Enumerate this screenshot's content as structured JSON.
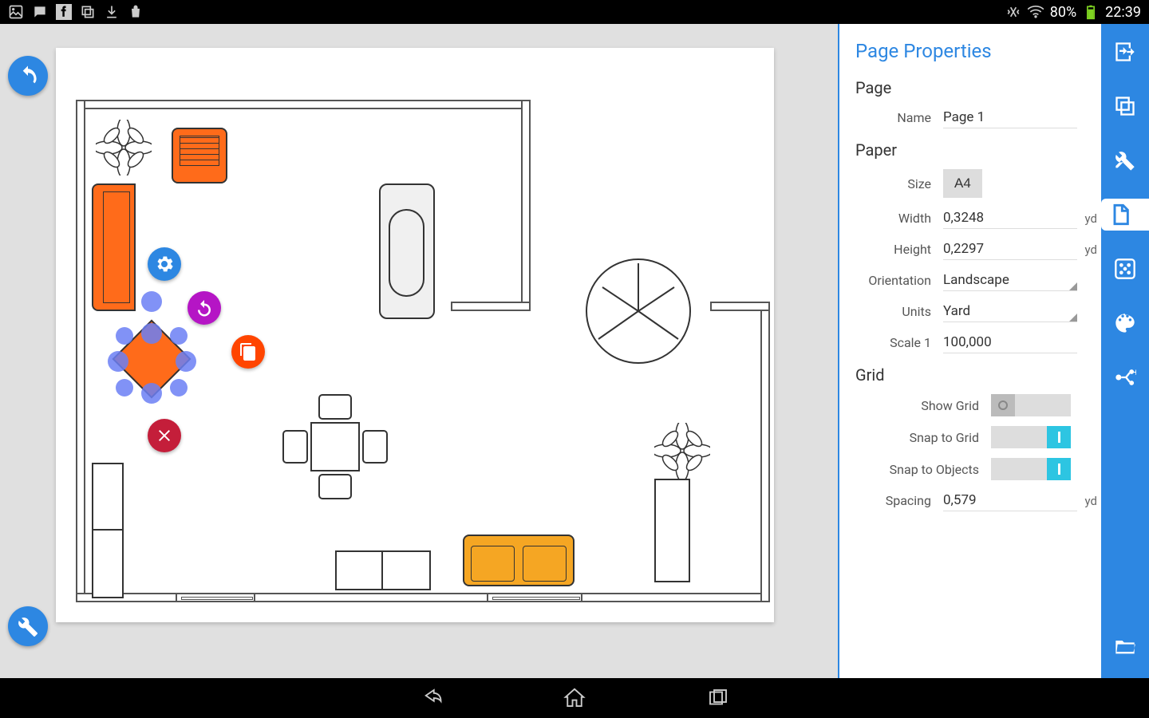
{
  "status": {
    "battery": "80%",
    "time": "22:39"
  },
  "panel": {
    "title": "Page Properties",
    "sections": {
      "page": {
        "title": "Page",
        "name_label": "Name",
        "name_value": "Page 1"
      },
      "paper": {
        "title": "Paper",
        "size_label": "Size",
        "size_value": "A4",
        "width_label": "Width",
        "width_value": "0,3248",
        "width_unit": "yd",
        "height_label": "Height",
        "height_value": "0,2297",
        "height_unit": "yd",
        "orientation_label": "Orientation",
        "orientation_value": "Landscape",
        "units_label": "Units",
        "units_value": "Yard",
        "scale_label": "Scale 1",
        "scale_value": "100,000"
      },
      "grid": {
        "title": "Grid",
        "show_grid_label": "Show Grid",
        "show_grid_on": false,
        "snap_grid_label": "Snap to Grid",
        "snap_grid_on": true,
        "snap_objects_label": "Snap to Objects",
        "snap_objects_on": true,
        "spacing_label": "Spacing",
        "spacing_value": "0,579",
        "spacing_unit": "yd"
      }
    }
  }
}
